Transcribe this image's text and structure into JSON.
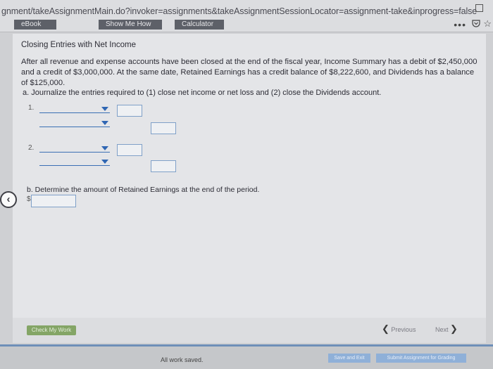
{
  "browser": {
    "url_path": "gnment/takeAssignmentMain.do?invoker=assignments&takeAssignmentSessionLocator=assignment-take&inprogress=false",
    "more_menu": "•••"
  },
  "toolbar": {
    "ebook": "eBook",
    "show_me_how": "Show Me How",
    "calculator": "Calculator"
  },
  "problem": {
    "title": "Closing Entries with Net Income",
    "description": "After all revenue and expense accounts have been closed at the end of the fiscal year, Income Summary has a debit of $2,450,000 and a credit of $3,000,000. At the same date, Retained Earnings has a credit balance of $8,222,600, and Dividends has a balance of $125,000.",
    "part_a": "a. Journalize the entries required to (1) close net income or net loss and (2) close the Dividends account.",
    "entry_1": "1.",
    "entry_2": "2.",
    "part_b": "b. Determine the amount of Retained Earnings at the end of the period.",
    "currency": "$"
  },
  "nav": {
    "check_my_work": "Check My Work",
    "previous": "Previous",
    "next": "Next"
  },
  "footer": {
    "status": "All work saved.",
    "save_and_exit": "Save and Exit",
    "submit": "Submit Assignment for Grading"
  }
}
